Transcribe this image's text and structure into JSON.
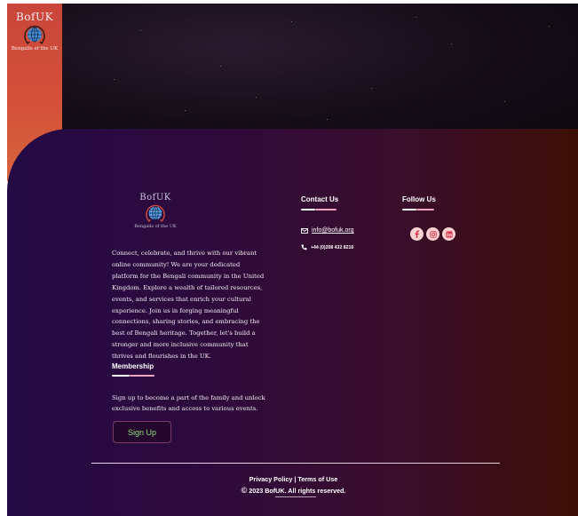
{
  "brand": {
    "name": "BofUK",
    "caption": "Bengalis of the UK"
  },
  "about": {
    "text": "Connect, celebrate, and thrive with our vibrant online community! We are your dedicated platform for the Bengali community in the United Kingdom. Explore a wealth of tailored resources, events, and services that enrich your cultural experience. Join us in forging meaningful connections, sharing stories, and embracing the best of Bengali heritage. Together, let's build a stronger and more inclusive community that thrives and flourishes in the UK."
  },
  "membership": {
    "heading": "Membership",
    "text": "Sign up to become a part of the family and unlock exclusive benefits and access to various events.",
    "button_label": "Sign Up"
  },
  "contact": {
    "heading": "Contact Us",
    "email": "info@bofuk.org",
    "phone": "+44 (0)208 432 8216"
  },
  "follow": {
    "heading": "Follow Us",
    "icons": [
      "facebook-icon",
      "instagram-icon",
      "linkedin-icon"
    ]
  },
  "footer": {
    "links": "Privacy Policy | Terms of Use",
    "copyright_symbol": "©",
    "copyright": "2023 BofUK. All rights reserved."
  },
  "colors": {
    "accent_red": "#c9463a",
    "underline_pink": "#f0a6c0",
    "signup_text": "#8fe07a",
    "social_bg": "#fbd2d2",
    "social_icon": "#d8334a"
  }
}
